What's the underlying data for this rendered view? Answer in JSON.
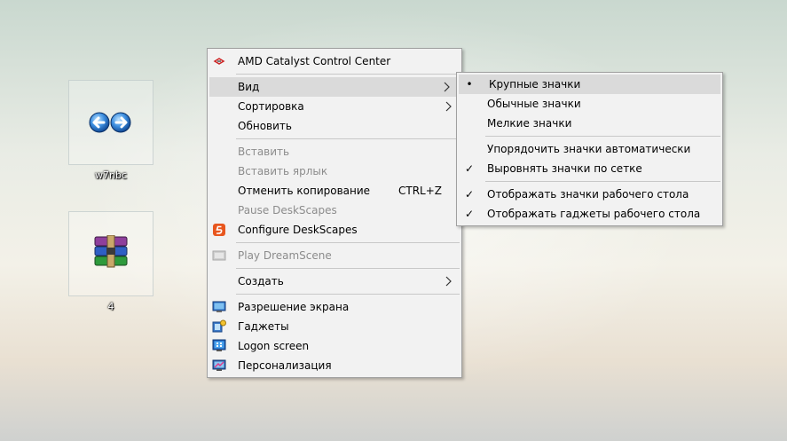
{
  "desktop": {
    "icons": [
      {
        "label": "w7nbc",
        "icon": "blue-arrows-icon"
      },
      {
        "label": "4",
        "icon": "winrar-archive-icon"
      }
    ]
  },
  "context_menu": {
    "items": [
      {
        "label": "AMD Catalyst Control Center",
        "icon": "amd-icon",
        "disabled": false
      },
      {
        "label": "Вид",
        "submenu": true,
        "highlighted": true
      },
      {
        "label": "Сортировка",
        "submenu": true
      },
      {
        "label": "Обновить"
      },
      {
        "label": "Вставить",
        "disabled": true
      },
      {
        "label": "Вставить ярлык",
        "disabled": true
      },
      {
        "label": "Отменить копирование",
        "shortcut": "CTRL+Z"
      },
      {
        "label": "Pause DeskScapes",
        "disabled": true
      },
      {
        "label": "Configure DeskScapes",
        "icon": "deskscapes-icon"
      },
      {
        "label": "Play DreamScene",
        "icon": "dreamscene-icon",
        "disabled": true
      },
      {
        "label": "Создать",
        "submenu": true
      },
      {
        "label": "Разрешение экрана",
        "icon": "monitor-icon"
      },
      {
        "label": "Гаджеты",
        "icon": "gadgets-icon"
      },
      {
        "label": "Logon screen",
        "icon": "logon-screen-icon"
      },
      {
        "label": "Персонализация",
        "icon": "personalization-icon"
      }
    ]
  },
  "view_submenu": {
    "items": [
      {
        "label": "Крупные значки",
        "mark": "•",
        "highlighted": true
      },
      {
        "label": "Обычные значки",
        "mark": ""
      },
      {
        "label": "Мелкие значки",
        "mark": ""
      },
      {
        "label": "Упорядочить значки автоматически",
        "mark": ""
      },
      {
        "label": "Выровнять значки по сетке",
        "mark": "✓"
      },
      {
        "label": "Отображать значки рабочего стола",
        "mark": "✓"
      },
      {
        "label": "Отображать гаджеты  рабочего стола",
        "mark": "✓"
      }
    ]
  },
  "colors": {
    "menu_bg": "#f2f2f2",
    "highlight": "#dadada",
    "disabled_text": "#8c8c8c"
  }
}
